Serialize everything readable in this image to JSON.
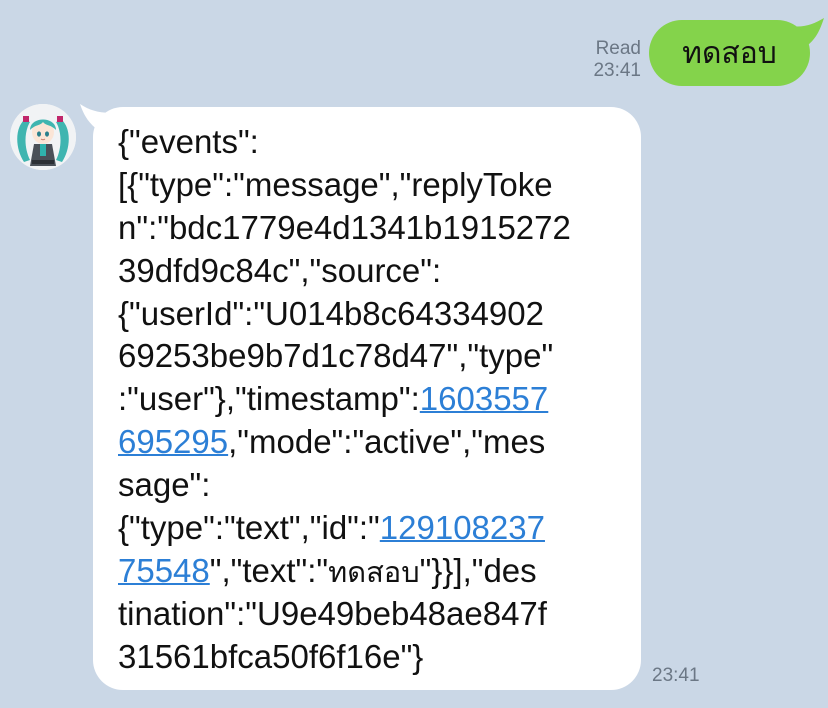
{
  "outgoing": {
    "status": "Read",
    "time": "23:41",
    "text": "ทดสอบ",
    "bubble_color": "#84d34b"
  },
  "incoming": {
    "avatar_icon": "anime-character-avatar-icon",
    "time": "23:41",
    "bubble_color": "#ffffff",
    "link_color": "#2c7fd6",
    "lines": [
      "{\"events\":",
      "[{\"type\":\"message\",\"replyToke",
      "n\":\"bdc1779e4d1341b1915272",
      "39dfd9c84c\",\"source\":",
      "{\"userId\":\"U014b8c64334902",
      "69253be9b7d1c78d47\",\"type\"",
      ":\"user\"},\"timestamp\":",
      "1603557",
      "695295",
      ",\"mode\":\"active\",\"mes",
      "sage\":",
      "{\"type\":\"text\",\"id\":\"",
      "129108237",
      "75548",
      "\",\"text\":\"",
      "ทดสอบ",
      "\"}}],\"des",
      "tination\":\"U9e49beb48ae847f",
      "31561bfca50f6f16e\"}"
    ]
  },
  "background_color": "#cad7e6"
}
